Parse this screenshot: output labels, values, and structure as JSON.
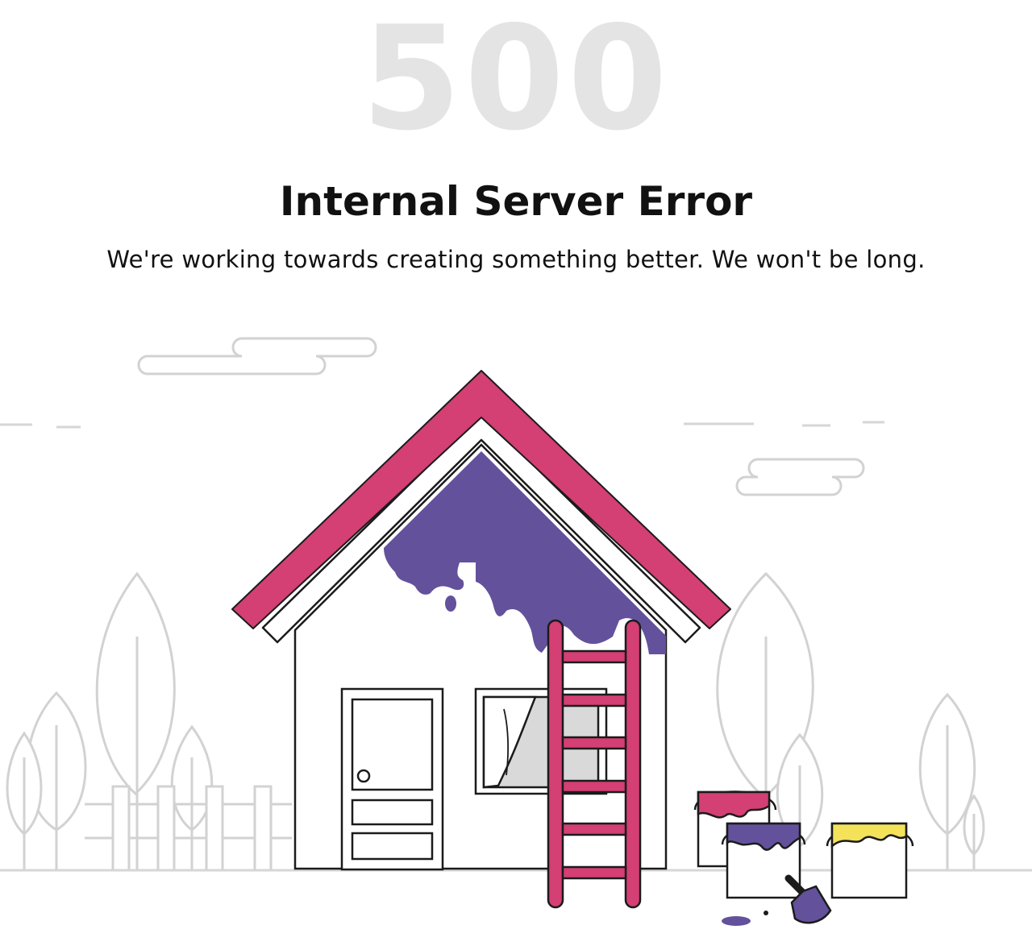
{
  "error": {
    "code": "500",
    "title": "Internal Server Error",
    "message": "We're working towards creating something better. We won't be long."
  },
  "illustration": {
    "icons": [
      "cloud-icon",
      "tree-icon",
      "fence-icon",
      "house-icon",
      "ladder-icon",
      "paint-bucket-icon",
      "paint-brush-icon"
    ]
  },
  "colors": {
    "code": "#e4e4e4",
    "roof": "#d43f74",
    "paint_purple": "#63519c",
    "paint_yellow": "#f3e25a",
    "line": "#1b1b1b",
    "outline_light": "#d2d2d2"
  }
}
